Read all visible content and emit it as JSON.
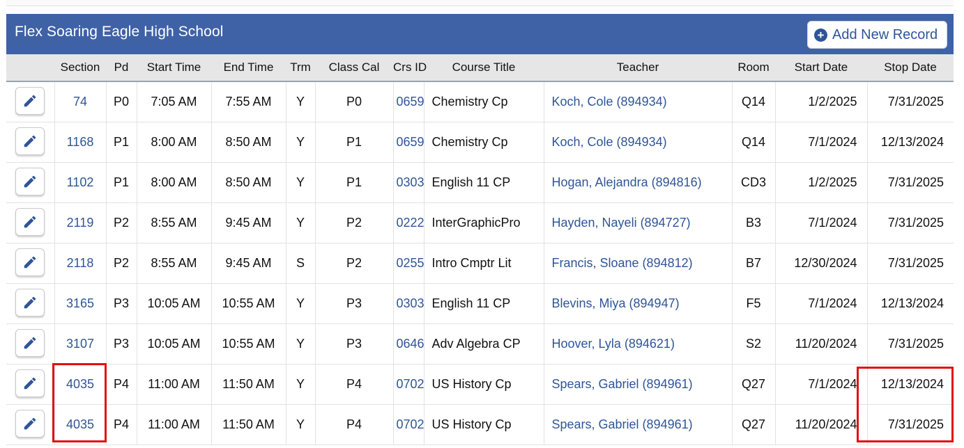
{
  "panel": {
    "title": "Flex Soaring Eagle High School",
    "add_button_label": "Add New Record",
    "add_button_icon": "plus-circle-icon"
  },
  "table": {
    "columns": [
      "",
      "Section",
      "Pd",
      "Start Time",
      "End Time",
      "Trm",
      "Class Cal",
      "Crs ID",
      "Course Title",
      "Teacher",
      "Room",
      "Start Date",
      "Stop Date"
    ],
    "rows": [
      {
        "section": "74",
        "pd": "P0",
        "start_time": "7:05 AM",
        "end_time": "7:55 AM",
        "trm": "Y",
        "class_cal": "P0",
        "crs_id": "0659",
        "course_title": "Chemistry Cp",
        "teacher": "Koch, Cole (894934)",
        "room": "Q14",
        "start_date": "1/2/2025",
        "stop_date": "7/31/2025"
      },
      {
        "section": "1168",
        "pd": "P1",
        "start_time": "8:00 AM",
        "end_time": "8:50 AM",
        "trm": "Y",
        "class_cal": "P1",
        "crs_id": "0659",
        "course_title": "Chemistry Cp",
        "teacher": "Koch, Cole (894934)",
        "room": "Q14",
        "start_date": "7/1/2024",
        "stop_date": "12/13/2024"
      },
      {
        "section": "1102",
        "pd": "P1",
        "start_time": "8:00 AM",
        "end_time": "8:50 AM",
        "trm": "Y",
        "class_cal": "P1",
        "crs_id": "0303",
        "course_title": "English 11 CP",
        "teacher": "Hogan, Alejandra (894816)",
        "room": "CD3",
        "start_date": "1/2/2025",
        "stop_date": "7/31/2025"
      },
      {
        "section": "2119",
        "pd": "P2",
        "start_time": "8:55 AM",
        "end_time": "9:45 AM",
        "trm": "Y",
        "class_cal": "P2",
        "crs_id": "0222",
        "course_title": "InterGraphicPro",
        "teacher": "Hayden, Nayeli (894727)",
        "room": "B3",
        "start_date": "7/1/2024",
        "stop_date": "7/31/2025"
      },
      {
        "section": "2118",
        "pd": "P2",
        "start_time": "8:55 AM",
        "end_time": "9:45 AM",
        "trm": "S",
        "class_cal": "P2",
        "crs_id": "0255",
        "course_title": "Intro Cmptr Lit",
        "teacher": "Francis, Sloane (894812)",
        "room": "B7",
        "start_date": "12/30/2024",
        "stop_date": "7/31/2025"
      },
      {
        "section": "3165",
        "pd": "P3",
        "start_time": "10:05 AM",
        "end_time": "10:55 AM",
        "trm": "Y",
        "class_cal": "P3",
        "crs_id": "0303",
        "course_title": "English 11 CP",
        "teacher": "Blevins, Miya (894947)",
        "room": "F5",
        "start_date": "7/1/2024",
        "stop_date": "12/13/2024"
      },
      {
        "section": "3107",
        "pd": "P3",
        "start_time": "10:05 AM",
        "end_time": "10:55 AM",
        "trm": "Y",
        "class_cal": "P3",
        "crs_id": "0646",
        "course_title": "Adv Algebra CP",
        "teacher": "Hoover, Lyla (894621)",
        "room": "S2",
        "start_date": "11/20/2024",
        "stop_date": "7/31/2025"
      },
      {
        "section": "4035",
        "pd": "P4",
        "start_time": "11:00 AM",
        "end_time": "11:50 AM",
        "trm": "Y",
        "class_cal": "P4",
        "crs_id": "0702",
        "course_title": "US History Cp",
        "teacher": "Spears, Gabriel (894961)",
        "room": "Q27",
        "start_date": "7/1/2024",
        "stop_date": "12/13/2024"
      },
      {
        "section": "4035",
        "pd": "P4",
        "start_time": "11:00 AM",
        "end_time": "11:50 AM",
        "trm": "Y",
        "class_cal": "P4",
        "crs_id": "0702",
        "course_title": "US History Cp",
        "teacher": "Spears, Gabriel (894961)",
        "room": "Q27",
        "start_date": "11/20/2024",
        "stop_date": "7/31/2025"
      }
    ]
  },
  "colors": {
    "header_bg": "#3f62a6",
    "link": "#2f5597",
    "highlight": "#e01010"
  }
}
